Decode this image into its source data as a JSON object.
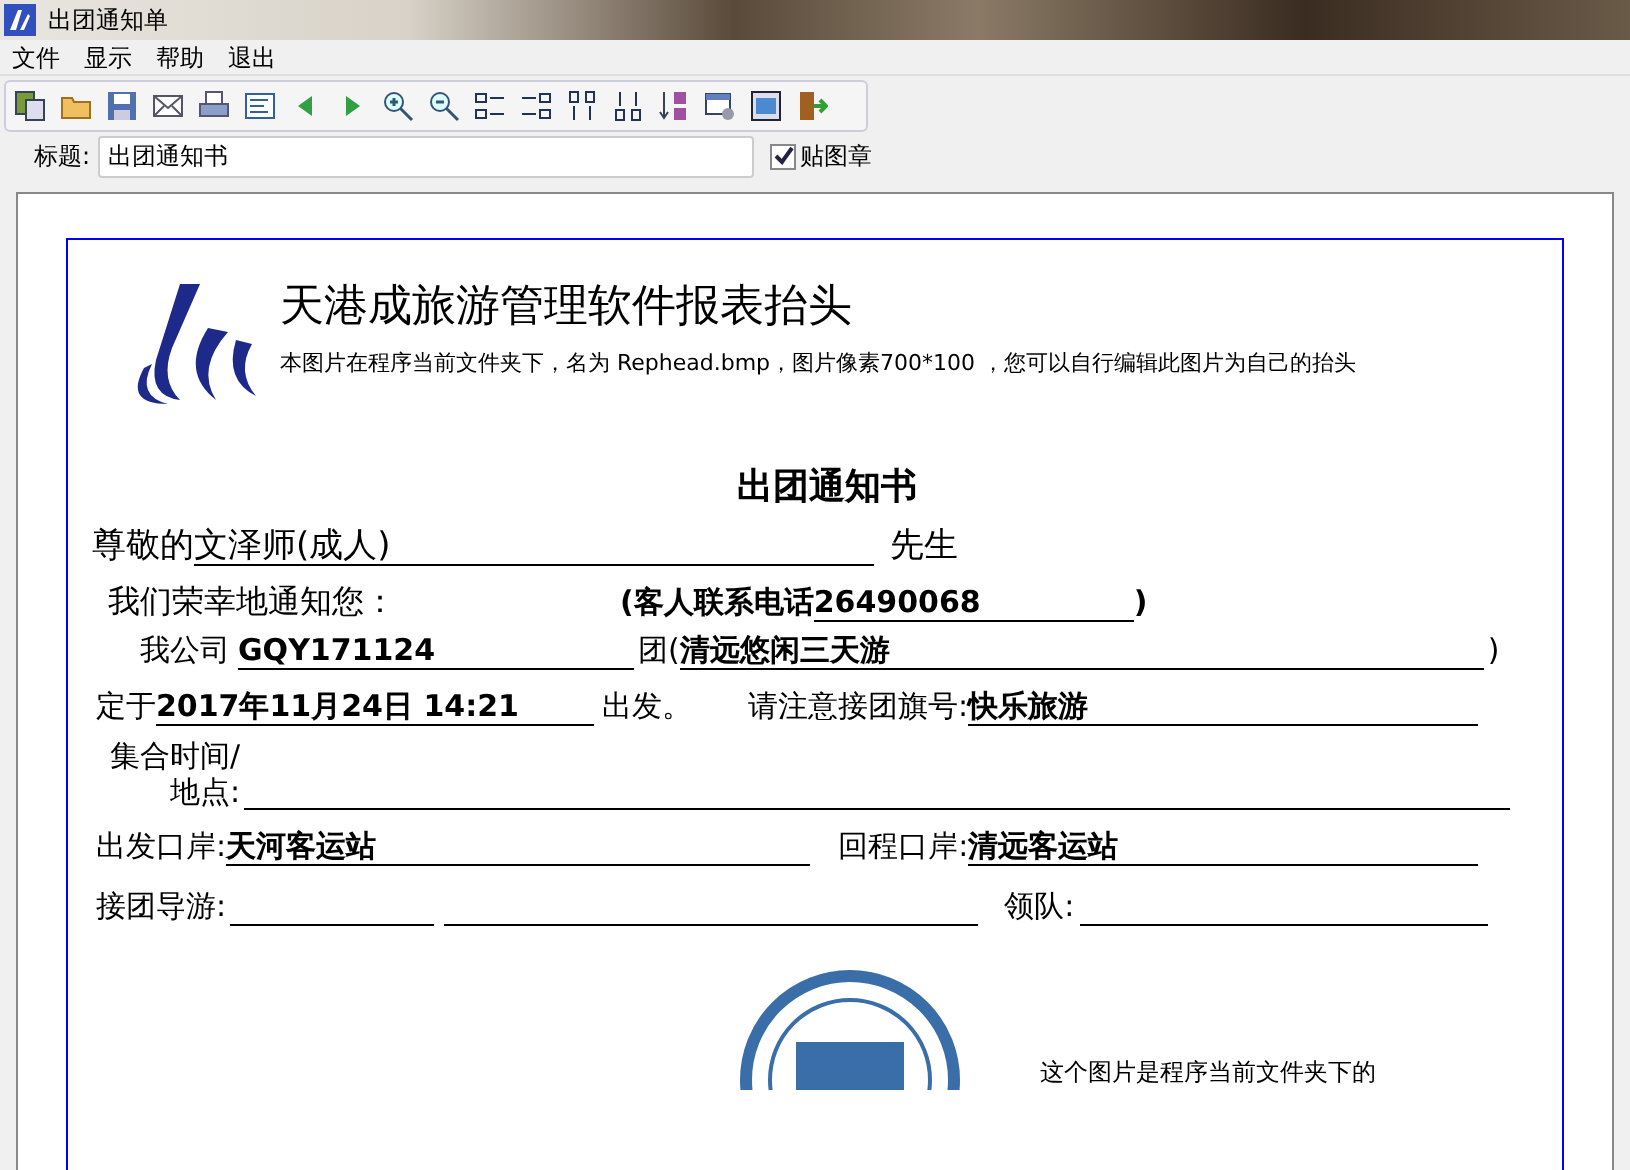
{
  "window": {
    "title": "出团通知单"
  },
  "menu": [
    "文件",
    "显示",
    "帮助",
    "退出"
  ],
  "title_field": {
    "label": "标题:",
    "value": "出团通知书"
  },
  "stamp_checkbox": {
    "label": "贴图章",
    "checked": true
  },
  "report": {
    "header": {
      "title": "天港成旅游管理软件报表抬头",
      "note": "本图片在程序当前文件夹下，名为 Rephead.bmp，图片像素700*100 ，您可以自行编辑此图片为自己的抬头"
    },
    "heading": "出团通知书",
    "greeting": {
      "label": "尊敬的",
      "name": "文泽师(成人)",
      "suffix": "先生"
    },
    "intro": "我们荣幸地通知您：",
    "contact": {
      "open": "(客人联系电话",
      "value": "26490068",
      "close": ")"
    },
    "group": {
      "label": "我公司",
      "code": "GQY171124",
      "mid": "团(",
      "name": "清远悠闲三天游",
      "close": ")"
    },
    "depart": {
      "label": "定于",
      "datetime": "2017年11月24日 14:21",
      "suffix": "出发。",
      "flag_label": "请注意接团旗号:",
      "flag": "快乐旅游"
    },
    "meeting": {
      "label_line1": "集合时间/",
      "label_line2": "地点:"
    },
    "ports": {
      "out_label": "出发口岸:",
      "out": "天河客运站",
      "back_label": "回程口岸:",
      "back": "清远客运站"
    },
    "guide": {
      "label": "接团导游:",
      "leader_label": "领队:"
    },
    "stamp_note": "这个图片是程序当前文件夹下的"
  }
}
